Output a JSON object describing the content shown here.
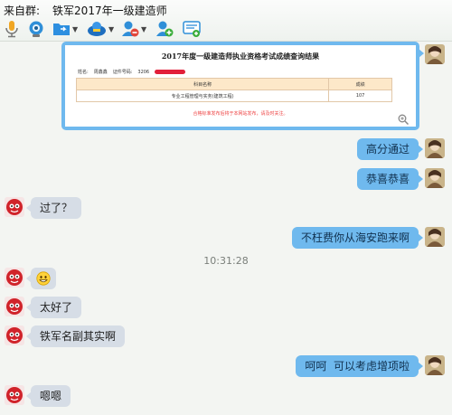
{
  "header": {
    "from_label": "来自群:",
    "group_name": "铁军2017年一级建造师"
  },
  "toolbar": {
    "icons": [
      "microphone-icon",
      "search-icon",
      "folder-icon",
      "share-icon",
      "remove-member-icon",
      "add-member-icon",
      "announcement-icon"
    ]
  },
  "image_message": {
    "title": "2017年度一级建造师执业资格考试成绩查询结果",
    "name_label": "姓名:",
    "name_value": "周鑫鑫",
    "id_label": "证件号码:",
    "id_value": "3206",
    "table": {
      "headers": [
        "科目名称",
        "成绩"
      ],
      "rows": [
        [
          "专业工程管理与实务(建筑工程)",
          "107"
        ]
      ]
    },
    "note": "合格标准发布后将于本网站发布，请及时关注。"
  },
  "messages": [
    {
      "side": "out",
      "text": "高分通过"
    },
    {
      "side": "out",
      "text": "恭喜恭喜"
    },
    {
      "side": "in",
      "text": "过了？"
    },
    {
      "side": "out",
      "text": "不枉费你从海安跑来啊"
    },
    {
      "side": "in",
      "emoji": "smiley"
    },
    {
      "side": "in",
      "text": "太好了"
    },
    {
      "side": "in",
      "text": "铁军名副其实啊"
    },
    {
      "side": "out",
      "text": "呵呵  可以考虑增项啦"
    },
    {
      "side": "in",
      "text": "嗯嗯"
    }
  ],
  "timestamp": "10:31:28",
  "colors": {
    "incoming_bubble": "#d6dde6",
    "outgoing_bubble": "#6fb9ee",
    "redaction": "#e21f3a"
  }
}
